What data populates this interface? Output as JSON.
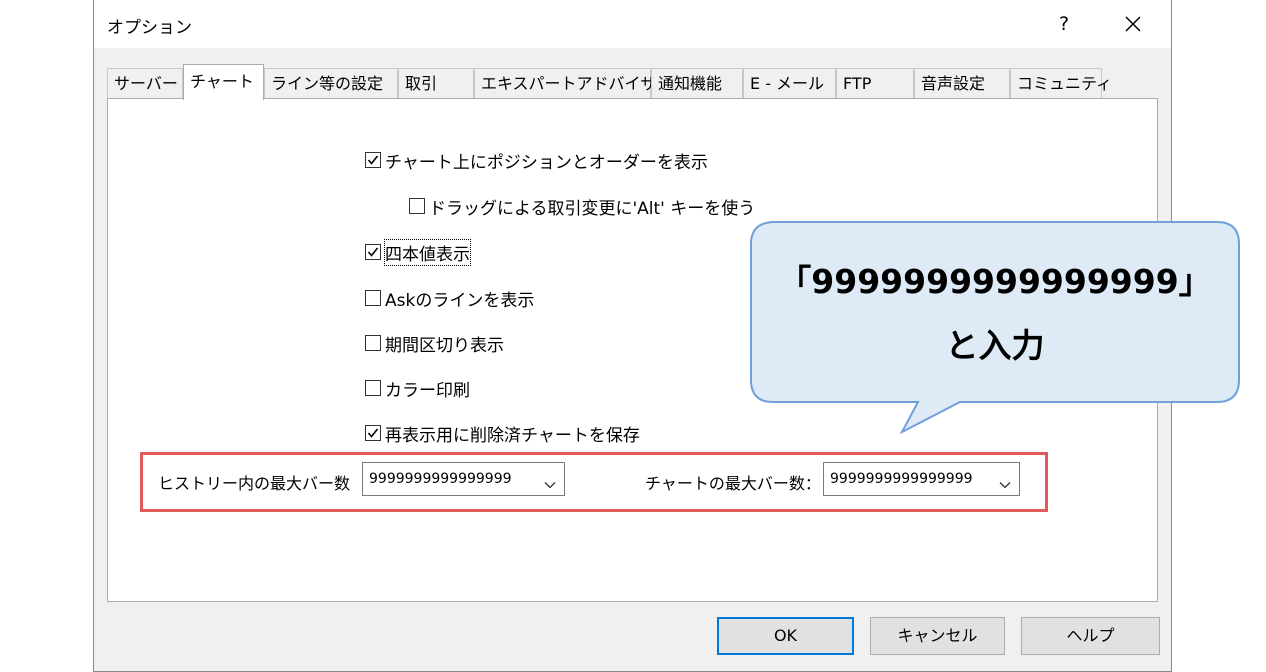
{
  "window": {
    "title": "オプション",
    "help_symbol": "?"
  },
  "tabs": [
    {
      "label": "サーバー"
    },
    {
      "label": "チャート",
      "active": true
    },
    {
      "label": "ライン等の設定"
    },
    {
      "label": "取引"
    },
    {
      "label": "エキスパートアドバイザ"
    },
    {
      "label": "通知機能"
    },
    {
      "label": "E - メール"
    },
    {
      "label": "FTP"
    },
    {
      "label": "音声設定"
    },
    {
      "label": "コミュニティ"
    }
  ],
  "checkboxes": [
    {
      "label": "チャート上にポジションとオーダーを表示",
      "checked": true
    },
    {
      "label": "ドラッグによる取引変更に'Alt' キーを使う",
      "checked": false
    },
    {
      "label": "四本値表示",
      "checked": true
    },
    {
      "label": "Askのラインを表示",
      "checked": false
    },
    {
      "label": "期間区切り表示",
      "checked": false
    },
    {
      "label": "カラー印刷",
      "checked": false
    },
    {
      "label": "再表示用に削除済チャートを保存",
      "checked": true
    }
  ],
  "max_bars_history": {
    "label": "ヒストリー内の最大バー数",
    "value": "9999999999999999"
  },
  "max_bars_chart": {
    "label": "チャートの最大バー数：",
    "value": "9999999999999999"
  },
  "buttons": {
    "ok": "OK",
    "cancel": "キャンセル",
    "help": "ヘルプ"
  },
  "callout": {
    "line1": "「9999999999999999」",
    "line2": "と入力"
  },
  "colors": {
    "highlight_border": "#e05a5a",
    "callout_fill": "#deebf7",
    "callout_border": "#6fa0d8",
    "default_button_border": "#0078d7"
  }
}
